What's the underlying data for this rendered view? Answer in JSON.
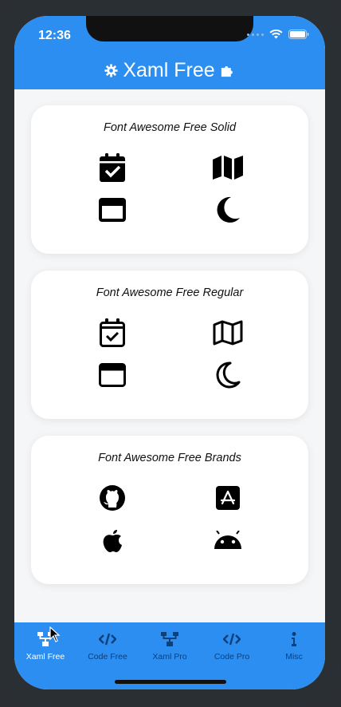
{
  "status_bar": {
    "time": "12:36"
  },
  "header": {
    "title": "Xaml Free"
  },
  "cards": [
    {
      "title": "Font Awesome Free Solid",
      "icons": [
        "calendar-check-solid",
        "map-solid",
        "window-maximize-solid",
        "moon-solid"
      ]
    },
    {
      "title": "Font Awesome Free Regular",
      "icons": [
        "calendar-check-regular",
        "map-regular",
        "window-maximize-regular",
        "moon-regular"
      ]
    },
    {
      "title": "Font Awesome Free Brands",
      "icons": [
        "github",
        "app-store",
        "apple",
        "android"
      ]
    }
  ],
  "tabs": [
    {
      "label": "Xaml Free",
      "icon": "sitemap-icon",
      "active": true
    },
    {
      "label": "Code Free",
      "icon": "code-icon",
      "active": false
    },
    {
      "label": "Xaml Pro",
      "icon": "sitemap-icon",
      "active": false
    },
    {
      "label": "Code Pro",
      "icon": "code-icon",
      "active": false
    },
    {
      "label": "Misc",
      "icon": "info-icon",
      "active": false
    }
  ],
  "colors": {
    "accent": "#2b8ef0",
    "tab_inactive_text": "#0d3f7a",
    "tab_active_text": "#ffffff",
    "background": "#f5f6f8"
  }
}
